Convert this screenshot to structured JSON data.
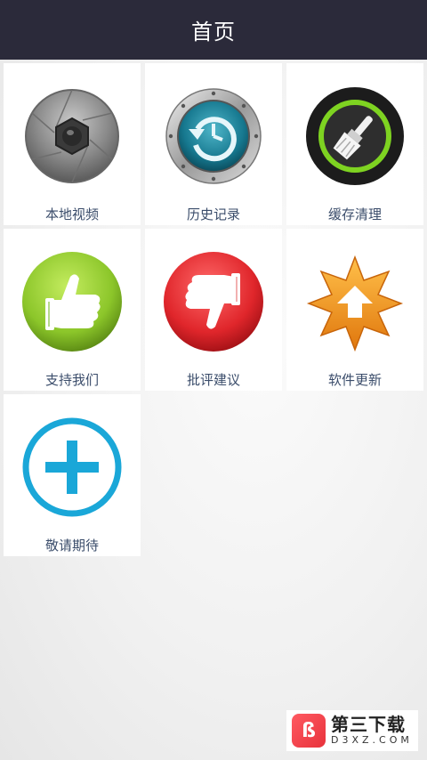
{
  "header": {
    "title": "首页"
  },
  "tiles": [
    {
      "label": "本地视频",
      "icon": "camera-lens-icon"
    },
    {
      "label": "历史记录",
      "icon": "history-clock-icon"
    },
    {
      "label": "缓存清理",
      "icon": "broom-clean-icon"
    },
    {
      "label": "支持我们",
      "icon": "thumbs-up-icon"
    },
    {
      "label": "批评建议",
      "icon": "thumbs-down-icon"
    },
    {
      "label": "软件更新",
      "icon": "update-arrow-icon"
    },
    {
      "label": "敬请期待",
      "icon": "plus-circle-icon"
    }
  ],
  "watermark": {
    "logo_char": "ß",
    "title": "第三下载",
    "subtitle": "D3XZ.COM"
  },
  "colors": {
    "header_bg": "#2b2a3a",
    "label": "#3b4d6b",
    "accent_blue": "#1aa7d8"
  }
}
